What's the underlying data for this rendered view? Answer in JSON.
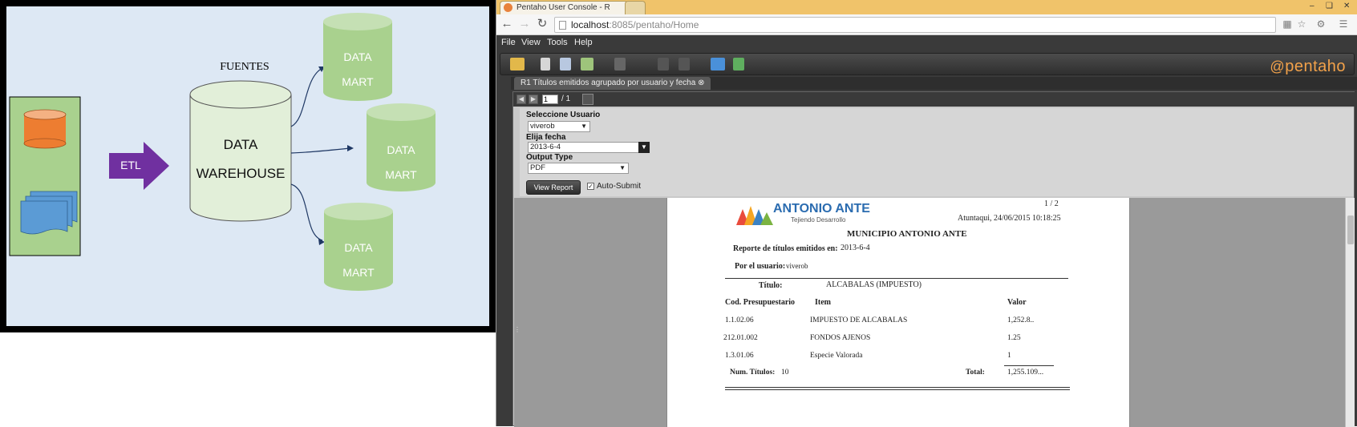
{
  "diagram": {
    "sources_label": "FUENTES",
    "etl_label": "ETL",
    "warehouse_line1": "DATA",
    "warehouse_line2": "WAREHOUSE",
    "marts": [
      {
        "line1": "DATA",
        "line2": "MART"
      },
      {
        "line1": "DATA",
        "line2": "MART"
      },
      {
        "line1": "DATA",
        "line2": "MART"
      }
    ],
    "colors": {
      "mart": "#a9d18e",
      "warehouse": "#e2efd9",
      "source_db": "#ed7d31",
      "source_docs": "#5b9bd5",
      "etl_arrow": "#7030a0",
      "source_box": "#a9d18e"
    }
  },
  "browser": {
    "tab_title": "Pentaho User Console - R",
    "url_host": "localhost",
    "url_rest": ":8085/pentaho/Home",
    "menu": [
      "File",
      "View",
      "Tools",
      "Help"
    ],
    "logo": "pentaho",
    "doc_tab": "R1 Títulos emitidos agrupado por usuario y fecha",
    "pager": {
      "current": "1",
      "total": "/ 1"
    },
    "params": {
      "user_label": "Seleccione Usuario",
      "user_value": "viverob",
      "date_label": "Elija fecha",
      "date_value": "2013-6-4",
      "output_label": "Output Type",
      "output_value": "PDF",
      "view_report": "View Report",
      "auto_submit": "Auto-Submit"
    }
  },
  "report": {
    "page_indicator": "1 / 2",
    "logo_name": "ANTONIO ANTE",
    "logo_tagline": "Tejiendo Desarrollo",
    "place_date": "Atuntaqui,   24/06/2015 10:18:25",
    "heading": "MUNICIPIO ANTONIO ANTE",
    "report_label": "Reporte de títulos emitidos en:",
    "report_value": "2013-6-4",
    "user_label": "Por el usuario:",
    "user_value": "viverob",
    "title_label": "Título:",
    "title_value": "ALCABALAS (IMPUESTO)",
    "columns": [
      "Cod. Presupuestario",
      "Item",
      "Valor"
    ],
    "rows": [
      {
        "code": "1.1.02.06",
        "item": "IMPUESTO DE ALCABALAS",
        "value": "1,252.8.."
      },
      {
        "code": "212.01.002",
        "item": "FONDOS AJENOS",
        "value": "1.25"
      },
      {
        "code": "1.3.01.06",
        "item": "Especie Valorada",
        "value": "1"
      }
    ],
    "count_label": "Num. Títulos:",
    "count_value": "10",
    "total_label": "Total:",
    "total_value": "1,255.109..."
  }
}
